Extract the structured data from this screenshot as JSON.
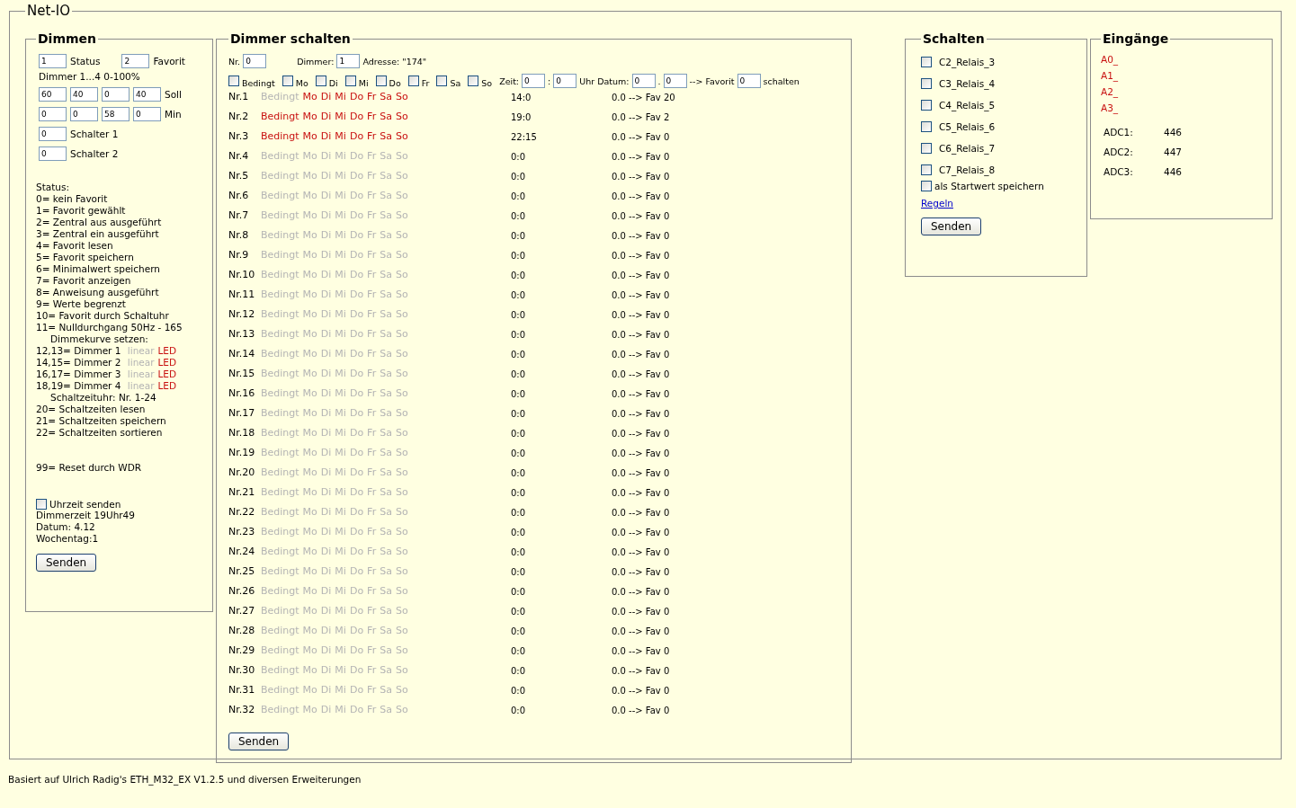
{
  "title": "Net-IO",
  "dimmen": {
    "legend": "Dimmen",
    "top_fields": [
      {
        "value": "1",
        "label": "Status"
      },
      {
        "value": "2",
        "label": "Favorit"
      }
    ],
    "range_label": "Dimmer 1...4 0-100%",
    "groups": [
      {
        "values": [
          "60",
          "40",
          "0",
          "40"
        ],
        "label": "Soll"
      },
      {
        "values": [
          "0",
          "0",
          "58",
          "0"
        ],
        "label": "Min"
      },
      {
        "values": [
          "0"
        ],
        "label": "Schalter 1"
      },
      {
        "values": [
          "0"
        ],
        "label": "Schalter 2"
      }
    ],
    "status_lines": [
      {
        "kind": "plain",
        "text": "Status:"
      },
      {
        "kind": "plain",
        "text": "0= kein Favorit"
      },
      {
        "kind": "plain",
        "text": "1= Favorit gewählt"
      },
      {
        "kind": "plain",
        "text": "2= Zentral aus ausgeführt"
      },
      {
        "kind": "plain",
        "text": "3= Zentral ein ausgeführt"
      },
      {
        "kind": "plain",
        "text": "4= Favorit lesen"
      },
      {
        "kind": "plain",
        "text": "5= Favorit speichern"
      },
      {
        "kind": "plain",
        "text": "6= Minimalwert speichern"
      },
      {
        "kind": "plain",
        "text": "7= Favorit anzeigen"
      },
      {
        "kind": "plain",
        "text": "8= Anweisung ausgeführt"
      },
      {
        "kind": "plain",
        "text": "9= Werte begrenzt"
      },
      {
        "kind": "plain",
        "text": "10= Favorit durch Schaltuhr"
      },
      {
        "kind": "plain",
        "text": "11= Nulldurchgang 50Hz - 165"
      },
      {
        "kind": "indent",
        "text": "Dimmekurve setzen:"
      },
      {
        "kind": "curve",
        "text": "12,13= Dimmer 1",
        "options": [
          {
            "label": "linear",
            "selected": false
          },
          {
            "label": "LED",
            "selected": true
          }
        ]
      },
      {
        "kind": "curve",
        "text": "14,15= Dimmer 2",
        "options": [
          {
            "label": "linear",
            "selected": false
          },
          {
            "label": "LED",
            "selected": true
          }
        ]
      },
      {
        "kind": "curve",
        "text": "16,17= Dimmer 3",
        "options": [
          {
            "label": "linear",
            "selected": false
          },
          {
            "label": "LED",
            "selected": true
          }
        ]
      },
      {
        "kind": "curve",
        "text": "18,19= Dimmer 4",
        "options": [
          {
            "label": "linear",
            "selected": false
          },
          {
            "label": "LED",
            "selected": true
          }
        ]
      },
      {
        "kind": "indent",
        "text": "Schaltzeituhr: Nr. 1-24"
      },
      {
        "kind": "plain",
        "text": "20= Schaltzeiten lesen"
      },
      {
        "kind": "plain",
        "text": "21= Schaltzeiten speichern"
      },
      {
        "kind": "plain",
        "text": "22= Schaltzeiten sortieren"
      }
    ],
    "reset_line": "99= Reset durch WDR",
    "time_send": {
      "label": "Uhrzeit senden",
      "checked": false
    },
    "info_lines": [
      "Dimmerzeit 19Uhr49",
      "Datum: 4.12",
      "Wochentag:1"
    ],
    "button": "Senden"
  },
  "schalten_dimmer": {
    "legend": "Dimmer schalten",
    "line1": [
      {
        "kind": "text",
        "text": "Nr."
      },
      {
        "kind": "input",
        "value": "0"
      },
      {
        "kind": "gap"
      },
      {
        "kind": "text",
        "text": "Dimmer:"
      },
      {
        "kind": "input",
        "value": "1"
      },
      {
        "kind": "text",
        "text": "Adresse: \"174\""
      }
    ],
    "line2": [
      {
        "kind": "checkbox",
        "label": "Bedingt",
        "checked": false
      },
      {
        "kind": "checkbox",
        "label": "Mo",
        "checked": false
      },
      {
        "kind": "checkbox",
        "label": "Di",
        "checked": false
      },
      {
        "kind": "checkbox",
        "label": "Mi",
        "checked": false
      },
      {
        "kind": "checkbox",
        "label": "Do",
        "checked": false
      },
      {
        "kind": "checkbox",
        "label": "Fr",
        "checked": false
      },
      {
        "kind": "checkbox",
        "label": "Sa",
        "checked": false
      },
      {
        "kind": "checkbox",
        "label": "So",
        "checked": false
      },
      {
        "kind": "text",
        "text": "Zeit:"
      },
      {
        "kind": "input",
        "value": "0"
      },
      {
        "kind": "text",
        "text": ":"
      },
      {
        "kind": "input",
        "value": "0"
      },
      {
        "kind": "text",
        "text": "Uhr Datum:"
      },
      {
        "kind": "input",
        "value": "0"
      },
      {
        "kind": "text",
        "text": "."
      },
      {
        "kind": "input",
        "value": "0"
      },
      {
        "kind": "text",
        "text": "--> Favorit"
      },
      {
        "kind": "input",
        "value": "0"
      },
      {
        "kind": "text",
        "text": "schalten"
      }
    ],
    "rows": [
      {
        "nr": "Nr.1",
        "flags": [
          {
            "label": "Bedingt",
            "on": false
          },
          {
            "label": "Mo",
            "on": true
          },
          {
            "label": "Di",
            "on": true
          },
          {
            "label": "Mi",
            "on": true
          },
          {
            "label": "Do",
            "on": true
          },
          {
            "label": "Fr",
            "on": true
          },
          {
            "label": "Sa",
            "on": true
          },
          {
            "label": "So",
            "on": true
          }
        ],
        "time": "14:0",
        "target": "0.0 --> Fav 20"
      },
      {
        "nr": "Nr.2",
        "flags": [
          {
            "label": "Bedingt",
            "on": true
          },
          {
            "label": "Mo",
            "on": true
          },
          {
            "label": "Di",
            "on": true
          },
          {
            "label": "Mi",
            "on": true
          },
          {
            "label": "Do",
            "on": true
          },
          {
            "label": "Fr",
            "on": true
          },
          {
            "label": "Sa",
            "on": true
          },
          {
            "label": "So",
            "on": true
          }
        ],
        "time": "19:0",
        "target": "0.0 --> Fav 2"
      },
      {
        "nr": "Nr.3",
        "flags": [
          {
            "label": "Bedingt",
            "on": true
          },
          {
            "label": "Mo",
            "on": true
          },
          {
            "label": "Di",
            "on": true
          },
          {
            "label": "Mi",
            "on": true
          },
          {
            "label": "Do",
            "on": true
          },
          {
            "label": "Fr",
            "on": true
          },
          {
            "label": "Sa",
            "on": true
          },
          {
            "label": "So",
            "on": true
          }
        ],
        "time": "22:15",
        "target": "0.0 --> Fav 0"
      },
      {
        "nr": "Nr.4",
        "flags": [
          {
            "label": "Bedingt",
            "on": false
          },
          {
            "label": "Mo",
            "on": false
          },
          {
            "label": "Di",
            "on": false
          },
          {
            "label": "Mi",
            "on": false
          },
          {
            "label": "Do",
            "on": false
          },
          {
            "label": "Fr",
            "on": false
          },
          {
            "label": "Sa",
            "on": false
          },
          {
            "label": "So",
            "on": false
          }
        ],
        "time": "0:0",
        "target": "0.0 --> Fav 0"
      },
      {
        "nr": "Nr.5",
        "flags": [
          {
            "label": "Bedingt",
            "on": false
          },
          {
            "label": "Mo",
            "on": false
          },
          {
            "label": "Di",
            "on": false
          },
          {
            "label": "Mi",
            "on": false
          },
          {
            "label": "Do",
            "on": false
          },
          {
            "label": "Fr",
            "on": false
          },
          {
            "label": "Sa",
            "on": false
          },
          {
            "label": "So",
            "on": false
          }
        ],
        "time": "0:0",
        "target": "0.0 --> Fav 0"
      },
      {
        "nr": "Nr.6",
        "flags": [
          {
            "label": "Bedingt",
            "on": false
          },
          {
            "label": "Mo",
            "on": false
          },
          {
            "label": "Di",
            "on": false
          },
          {
            "label": "Mi",
            "on": false
          },
          {
            "label": "Do",
            "on": false
          },
          {
            "label": "Fr",
            "on": false
          },
          {
            "label": "Sa",
            "on": false
          },
          {
            "label": "So",
            "on": false
          }
        ],
        "time": "0:0",
        "target": "0.0 --> Fav 0"
      },
      {
        "nr": "Nr.7",
        "flags": [
          {
            "label": "Bedingt",
            "on": false
          },
          {
            "label": "Mo",
            "on": false
          },
          {
            "label": "Di",
            "on": false
          },
          {
            "label": "Mi",
            "on": false
          },
          {
            "label": "Do",
            "on": false
          },
          {
            "label": "Fr",
            "on": false
          },
          {
            "label": "Sa",
            "on": false
          },
          {
            "label": "So",
            "on": false
          }
        ],
        "time": "0:0",
        "target": "0.0 --> Fav 0"
      },
      {
        "nr": "Nr.8",
        "flags": [
          {
            "label": "Bedingt",
            "on": false
          },
          {
            "label": "Mo",
            "on": false
          },
          {
            "label": "Di",
            "on": false
          },
          {
            "label": "Mi",
            "on": false
          },
          {
            "label": "Do",
            "on": false
          },
          {
            "label": "Fr",
            "on": false
          },
          {
            "label": "Sa",
            "on": false
          },
          {
            "label": "So",
            "on": false
          }
        ],
        "time": "0:0",
        "target": "0.0 --> Fav 0"
      },
      {
        "nr": "Nr.9",
        "flags": [
          {
            "label": "Bedingt",
            "on": false
          },
          {
            "label": "Mo",
            "on": false
          },
          {
            "label": "Di",
            "on": false
          },
          {
            "label": "Mi",
            "on": false
          },
          {
            "label": "Do",
            "on": false
          },
          {
            "label": "Fr",
            "on": false
          },
          {
            "label": "Sa",
            "on": false
          },
          {
            "label": "So",
            "on": false
          }
        ],
        "time": "0:0",
        "target": "0.0 --> Fav 0"
      },
      {
        "nr": "Nr.10",
        "flags": [
          {
            "label": "Bedingt",
            "on": false
          },
          {
            "label": "Mo",
            "on": false
          },
          {
            "label": "Di",
            "on": false
          },
          {
            "label": "Mi",
            "on": false
          },
          {
            "label": "Do",
            "on": false
          },
          {
            "label": "Fr",
            "on": false
          },
          {
            "label": "Sa",
            "on": false
          },
          {
            "label": "So",
            "on": false
          }
        ],
        "time": "0:0",
        "target": "0.0 --> Fav 0"
      },
      {
        "nr": "Nr.11",
        "flags": [
          {
            "label": "Bedingt",
            "on": false
          },
          {
            "label": "Mo",
            "on": false
          },
          {
            "label": "Di",
            "on": false
          },
          {
            "label": "Mi",
            "on": false
          },
          {
            "label": "Do",
            "on": false
          },
          {
            "label": "Fr",
            "on": false
          },
          {
            "label": "Sa",
            "on": false
          },
          {
            "label": "So",
            "on": false
          }
        ],
        "time": "0:0",
        "target": "0.0 --> Fav 0"
      },
      {
        "nr": "Nr.12",
        "flags": [
          {
            "label": "Bedingt",
            "on": false
          },
          {
            "label": "Mo",
            "on": false
          },
          {
            "label": "Di",
            "on": false
          },
          {
            "label": "Mi",
            "on": false
          },
          {
            "label": "Do",
            "on": false
          },
          {
            "label": "Fr",
            "on": false
          },
          {
            "label": "Sa",
            "on": false
          },
          {
            "label": "So",
            "on": false
          }
        ],
        "time": "0:0",
        "target": "0.0 --> Fav 0"
      },
      {
        "nr": "Nr.13",
        "flags": [
          {
            "label": "Bedingt",
            "on": false
          },
          {
            "label": "Mo",
            "on": false
          },
          {
            "label": "Di",
            "on": false
          },
          {
            "label": "Mi",
            "on": false
          },
          {
            "label": "Do",
            "on": false
          },
          {
            "label": "Fr",
            "on": false
          },
          {
            "label": "Sa",
            "on": false
          },
          {
            "label": "So",
            "on": false
          }
        ],
        "time": "0:0",
        "target": "0.0 --> Fav 0"
      },
      {
        "nr": "Nr.14",
        "flags": [
          {
            "label": "Bedingt",
            "on": false
          },
          {
            "label": "Mo",
            "on": false
          },
          {
            "label": "Di",
            "on": false
          },
          {
            "label": "Mi",
            "on": false
          },
          {
            "label": "Do",
            "on": false
          },
          {
            "label": "Fr",
            "on": false
          },
          {
            "label": "Sa",
            "on": false
          },
          {
            "label": "So",
            "on": false
          }
        ],
        "time": "0:0",
        "target": "0.0 --> Fav 0"
      },
      {
        "nr": "Nr.15",
        "flags": [
          {
            "label": "Bedingt",
            "on": false
          },
          {
            "label": "Mo",
            "on": false
          },
          {
            "label": "Di",
            "on": false
          },
          {
            "label": "Mi",
            "on": false
          },
          {
            "label": "Do",
            "on": false
          },
          {
            "label": "Fr",
            "on": false
          },
          {
            "label": "Sa",
            "on": false
          },
          {
            "label": "So",
            "on": false
          }
        ],
        "time": "0:0",
        "target": "0.0 --> Fav 0"
      },
      {
        "nr": "Nr.16",
        "flags": [
          {
            "label": "Bedingt",
            "on": false
          },
          {
            "label": "Mo",
            "on": false
          },
          {
            "label": "Di",
            "on": false
          },
          {
            "label": "Mi",
            "on": false
          },
          {
            "label": "Do",
            "on": false
          },
          {
            "label": "Fr",
            "on": false
          },
          {
            "label": "Sa",
            "on": false
          },
          {
            "label": "So",
            "on": false
          }
        ],
        "time": "0:0",
        "target": "0.0 --> Fav 0"
      },
      {
        "nr": "Nr.17",
        "flags": [
          {
            "label": "Bedingt",
            "on": false
          },
          {
            "label": "Mo",
            "on": false
          },
          {
            "label": "Di",
            "on": false
          },
          {
            "label": "Mi",
            "on": false
          },
          {
            "label": "Do",
            "on": false
          },
          {
            "label": "Fr",
            "on": false
          },
          {
            "label": "Sa",
            "on": false
          },
          {
            "label": "So",
            "on": false
          }
        ],
        "time": "0:0",
        "target": "0.0 --> Fav 0"
      },
      {
        "nr": "Nr.18",
        "flags": [
          {
            "label": "Bedingt",
            "on": false
          },
          {
            "label": "Mo",
            "on": false
          },
          {
            "label": "Di",
            "on": false
          },
          {
            "label": "Mi",
            "on": false
          },
          {
            "label": "Do",
            "on": false
          },
          {
            "label": "Fr",
            "on": false
          },
          {
            "label": "Sa",
            "on": false
          },
          {
            "label": "So",
            "on": false
          }
        ],
        "time": "0:0",
        "target": "0.0 --> Fav 0"
      },
      {
        "nr": "Nr.19",
        "flags": [
          {
            "label": "Bedingt",
            "on": false
          },
          {
            "label": "Mo",
            "on": false
          },
          {
            "label": "Di",
            "on": false
          },
          {
            "label": "Mi",
            "on": false
          },
          {
            "label": "Do",
            "on": false
          },
          {
            "label": "Fr",
            "on": false
          },
          {
            "label": "Sa",
            "on": false
          },
          {
            "label": "So",
            "on": false
          }
        ],
        "time": "0:0",
        "target": "0.0 --> Fav 0"
      },
      {
        "nr": "Nr.20",
        "flags": [
          {
            "label": "Bedingt",
            "on": false
          },
          {
            "label": "Mo",
            "on": false
          },
          {
            "label": "Di",
            "on": false
          },
          {
            "label": "Mi",
            "on": false
          },
          {
            "label": "Do",
            "on": false
          },
          {
            "label": "Fr",
            "on": false
          },
          {
            "label": "Sa",
            "on": false
          },
          {
            "label": "So",
            "on": false
          }
        ],
        "time": "0:0",
        "target": "0.0 --> Fav 0"
      },
      {
        "nr": "Nr.21",
        "flags": [
          {
            "label": "Bedingt",
            "on": false
          },
          {
            "label": "Mo",
            "on": false
          },
          {
            "label": "Di",
            "on": false
          },
          {
            "label": "Mi",
            "on": false
          },
          {
            "label": "Do",
            "on": false
          },
          {
            "label": "Fr",
            "on": false
          },
          {
            "label": "Sa",
            "on": false
          },
          {
            "label": "So",
            "on": false
          }
        ],
        "time": "0:0",
        "target": "0.0 --> Fav 0"
      },
      {
        "nr": "Nr.22",
        "flags": [
          {
            "label": "Bedingt",
            "on": false
          },
          {
            "label": "Mo",
            "on": false
          },
          {
            "label": "Di",
            "on": false
          },
          {
            "label": "Mi",
            "on": false
          },
          {
            "label": "Do",
            "on": false
          },
          {
            "label": "Fr",
            "on": false
          },
          {
            "label": "Sa",
            "on": false
          },
          {
            "label": "So",
            "on": false
          }
        ],
        "time": "0:0",
        "target": "0.0 --> Fav 0"
      },
      {
        "nr": "Nr.23",
        "flags": [
          {
            "label": "Bedingt",
            "on": false
          },
          {
            "label": "Mo",
            "on": false
          },
          {
            "label": "Di",
            "on": false
          },
          {
            "label": "Mi",
            "on": false
          },
          {
            "label": "Do",
            "on": false
          },
          {
            "label": "Fr",
            "on": false
          },
          {
            "label": "Sa",
            "on": false
          },
          {
            "label": "So",
            "on": false
          }
        ],
        "time": "0:0",
        "target": "0.0 --> Fav 0"
      },
      {
        "nr": "Nr.24",
        "flags": [
          {
            "label": "Bedingt",
            "on": false
          },
          {
            "label": "Mo",
            "on": false
          },
          {
            "label": "Di",
            "on": false
          },
          {
            "label": "Mi",
            "on": false
          },
          {
            "label": "Do",
            "on": false
          },
          {
            "label": "Fr",
            "on": false
          },
          {
            "label": "Sa",
            "on": false
          },
          {
            "label": "So",
            "on": false
          }
        ],
        "time": "0:0",
        "target": "0.0 --> Fav 0"
      },
      {
        "nr": "Nr.25",
        "flags": [
          {
            "label": "Bedingt",
            "on": false
          },
          {
            "label": "Mo",
            "on": false
          },
          {
            "label": "Di",
            "on": false
          },
          {
            "label": "Mi",
            "on": false
          },
          {
            "label": "Do",
            "on": false
          },
          {
            "label": "Fr",
            "on": false
          },
          {
            "label": "Sa",
            "on": false
          },
          {
            "label": "So",
            "on": false
          }
        ],
        "time": "0:0",
        "target": "0.0 --> Fav 0"
      },
      {
        "nr": "Nr.26",
        "flags": [
          {
            "label": "Bedingt",
            "on": false
          },
          {
            "label": "Mo",
            "on": false
          },
          {
            "label": "Di",
            "on": false
          },
          {
            "label": "Mi",
            "on": false
          },
          {
            "label": "Do",
            "on": false
          },
          {
            "label": "Fr",
            "on": false
          },
          {
            "label": "Sa",
            "on": false
          },
          {
            "label": "So",
            "on": false
          }
        ],
        "time": "0:0",
        "target": "0.0 --> Fav 0"
      },
      {
        "nr": "Nr.27",
        "flags": [
          {
            "label": "Bedingt",
            "on": false
          },
          {
            "label": "Mo",
            "on": false
          },
          {
            "label": "Di",
            "on": false
          },
          {
            "label": "Mi",
            "on": false
          },
          {
            "label": "Do",
            "on": false
          },
          {
            "label": "Fr",
            "on": false
          },
          {
            "label": "Sa",
            "on": false
          },
          {
            "label": "So",
            "on": false
          }
        ],
        "time": "0:0",
        "target": "0.0 --> Fav 0"
      },
      {
        "nr": "Nr.28",
        "flags": [
          {
            "label": "Bedingt",
            "on": false
          },
          {
            "label": "Mo",
            "on": false
          },
          {
            "label": "Di",
            "on": false
          },
          {
            "label": "Mi",
            "on": false
          },
          {
            "label": "Do",
            "on": false
          },
          {
            "label": "Fr",
            "on": false
          },
          {
            "label": "Sa",
            "on": false
          },
          {
            "label": "So",
            "on": false
          }
        ],
        "time": "0:0",
        "target": "0.0 --> Fav 0"
      },
      {
        "nr": "Nr.29",
        "flags": [
          {
            "label": "Bedingt",
            "on": false
          },
          {
            "label": "Mo",
            "on": false
          },
          {
            "label": "Di",
            "on": false
          },
          {
            "label": "Mi",
            "on": false
          },
          {
            "label": "Do",
            "on": false
          },
          {
            "label": "Fr",
            "on": false
          },
          {
            "label": "Sa",
            "on": false
          },
          {
            "label": "So",
            "on": false
          }
        ],
        "time": "0:0",
        "target": "0.0 --> Fav 0"
      },
      {
        "nr": "Nr.30",
        "flags": [
          {
            "label": "Bedingt",
            "on": false
          },
          {
            "label": "Mo",
            "on": false
          },
          {
            "label": "Di",
            "on": false
          },
          {
            "label": "Mi",
            "on": false
          },
          {
            "label": "Do",
            "on": false
          },
          {
            "label": "Fr",
            "on": false
          },
          {
            "label": "Sa",
            "on": false
          },
          {
            "label": "So",
            "on": false
          }
        ],
        "time": "0:0",
        "target": "0.0 --> Fav 0"
      },
      {
        "nr": "Nr.31",
        "flags": [
          {
            "label": "Bedingt",
            "on": false
          },
          {
            "label": "Mo",
            "on": false
          },
          {
            "label": "Di",
            "on": false
          },
          {
            "label": "Mi",
            "on": false
          },
          {
            "label": "Do",
            "on": false
          },
          {
            "label": "Fr",
            "on": false
          },
          {
            "label": "Sa",
            "on": false
          },
          {
            "label": "So",
            "on": false
          }
        ],
        "time": "0:0",
        "target": "0.0 --> Fav 0"
      },
      {
        "nr": "Nr.32",
        "flags": [
          {
            "label": "Bedingt",
            "on": false
          },
          {
            "label": "Mo",
            "on": false
          },
          {
            "label": "Di",
            "on": false
          },
          {
            "label": "Mi",
            "on": false
          },
          {
            "label": "Do",
            "on": false
          },
          {
            "label": "Fr",
            "on": false
          },
          {
            "label": "Sa",
            "on": false
          },
          {
            "label": "So",
            "on": false
          }
        ],
        "time": "0:0",
        "target": "0.0 --> Fav 0"
      }
    ],
    "button": "Senden"
  },
  "schalten": {
    "legend": "Schalten",
    "relays": [
      {
        "label": "C2_Relais_3",
        "checked": false
      },
      {
        "label": "C3_Relais_4",
        "checked": false
      },
      {
        "label": "C4_Relais_5",
        "checked": false
      },
      {
        "label": "C5_Relais_6",
        "checked": false
      },
      {
        "label": "C6_Relais_7",
        "checked": false
      },
      {
        "label": "C7_Relais_8",
        "checked": false
      }
    ],
    "save": {
      "label": "als Startwert speichern",
      "checked": false
    },
    "link": "Regeln",
    "button": "Senden"
  },
  "eingaenge": {
    "legend": "Eingänge",
    "inputs": [
      "A0_",
      "A1_",
      "A2_",
      "A3_"
    ],
    "adc": [
      {
        "label": "ADC1:",
        "value": "446"
      },
      {
        "label": "ADC2:",
        "value": "447"
      },
      {
        "label": "ADC3:",
        "value": "446"
      }
    ]
  },
  "footer": "Basiert auf Ulrich Radig's ETH_M32_EX V1.2.5 und diversen Erweiterungen"
}
